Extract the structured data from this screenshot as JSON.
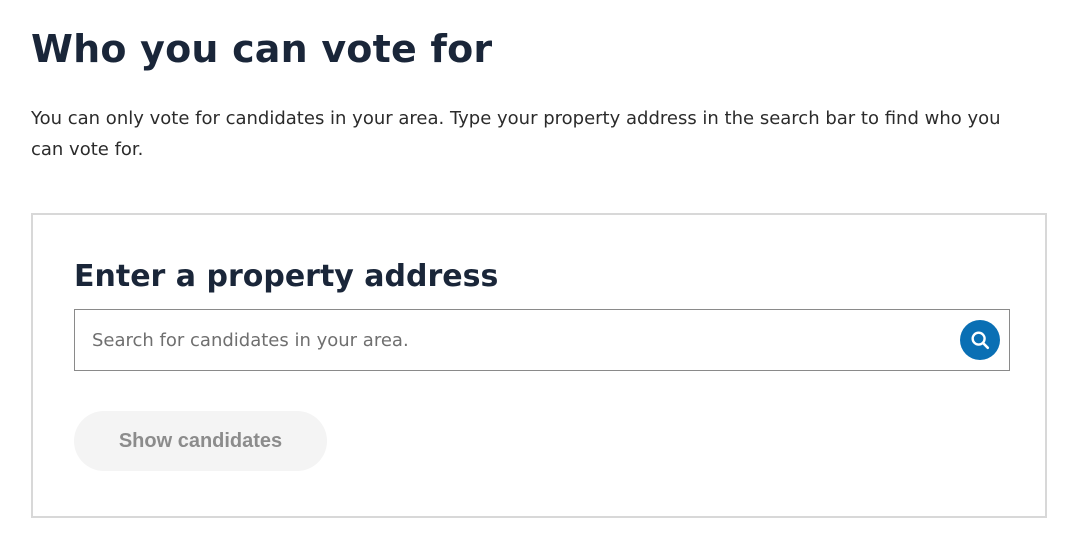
{
  "header": {
    "title": "Who you can vote for",
    "intro": "You can only vote for candidates in your area. Type your property address in the search bar to find who you can vote for."
  },
  "search_card": {
    "heading": "Enter a property address",
    "search": {
      "value": "",
      "placeholder": "Search for candidates in your area.",
      "button_icon": "search-icon"
    },
    "submit": {
      "label": "Show candidates",
      "state": "disabled"
    }
  },
  "colors": {
    "heading": "#1a2639",
    "accent": "#0a6fb4",
    "card_border": "#d8d8d8",
    "disabled_button_bg": "#f4f4f4",
    "disabled_button_text": "#8c8c8c"
  }
}
